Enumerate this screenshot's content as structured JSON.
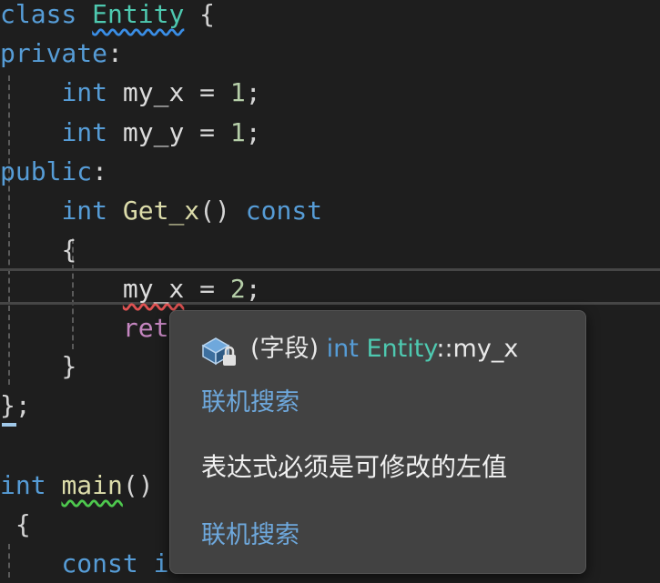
{
  "editor": {
    "lines": {
      "l1": {
        "kw": "class",
        "name": "Entity",
        "brace": "{"
      },
      "l2": {
        "kw": "private",
        "colon": ":"
      },
      "l3": {
        "type": "int",
        "var": "my_x",
        "op": "=",
        "num": "1",
        "semi": ";"
      },
      "l4": {
        "type": "int",
        "var": "my_y",
        "op": "=",
        "num": "1",
        "semi": ";"
      },
      "l5": {
        "kw": "public",
        "colon": ":"
      },
      "l6": {
        "type": "int",
        "fn": "Get_x",
        "parens": "()",
        "kw2": "const"
      },
      "l7": {
        "brace": "{"
      },
      "l8": {
        "var": "my_x",
        "op": "=",
        "num": "2",
        "semi": ";"
      },
      "l9": {
        "kw": "ret"
      },
      "l10": {
        "brace": "}"
      },
      "l11": {
        "brace": "}",
        "semi": ";"
      },
      "l13": {
        "type": "int",
        "fn": "main",
        "parens": "()"
      },
      "l14": {
        "brace": "{"
      },
      "l15": {
        "kw": "const",
        "partial": "i"
      }
    }
  },
  "quickinfo": {
    "icon": "field-private-icon",
    "kind": "(字段)",
    "type": "int",
    "class_name": "Entity",
    "scope": "::",
    "member": "my_x",
    "search_link_1": "联机搜索",
    "error_message": "表达式必须是可修改的左值",
    "search_link_2": "联机搜索"
  },
  "colors": {
    "background": "#1e1e1e",
    "keyword": "#569cd6",
    "type": "#4ec9b0",
    "function": "#dcdcaa",
    "number": "#b5cea8",
    "control": "#c586c0",
    "popup_bg": "#424242",
    "link": "#6ea8dc"
  }
}
